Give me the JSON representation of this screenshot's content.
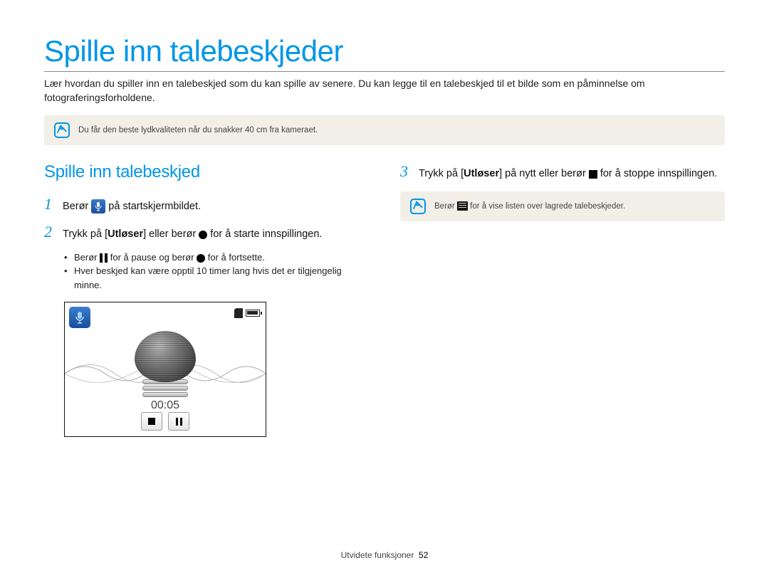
{
  "page_title": "Spille inn talebeskjeder",
  "intro": "Lær hvordan du spiller inn en talebeskjed som du kan spille av senere. Du kan legge til en talebeskjed til et bilde som en påminnelse om fotograferingsforholdene.",
  "tip1": "Du får den beste lydkvaliteten når du snakker 40 cm fra kameraet.",
  "section_title": "Spille inn talebeskjed",
  "step1_a": "Berør ",
  "step1_b": " på startskjermbildet.",
  "step2_a": "Trykk på [",
  "step2_bold": "Utløser",
  "step2_b": "] eller berør ",
  "step2_c": " for å starte innspillingen.",
  "bullet1_a": "Berør ",
  "bullet1_b": " for å pause og berør ",
  "bullet1_c": " for å fortsette.",
  "bullet2": "Hver beskjed kan være opptil 10 timer lang hvis det er tilgjengelig minne.",
  "timer": "00:05",
  "step3_a": "Trykk på [",
  "step3_bold": "Utløser",
  "step3_b": "] på nytt eller berør ",
  "step3_c": " for å stoppe innspillingen.",
  "tip2_a": "Berør ",
  "tip2_b": " for å vise listen over lagrede talebeskjeder.",
  "footer_section": "Utvidete funksjoner",
  "footer_page": "52"
}
